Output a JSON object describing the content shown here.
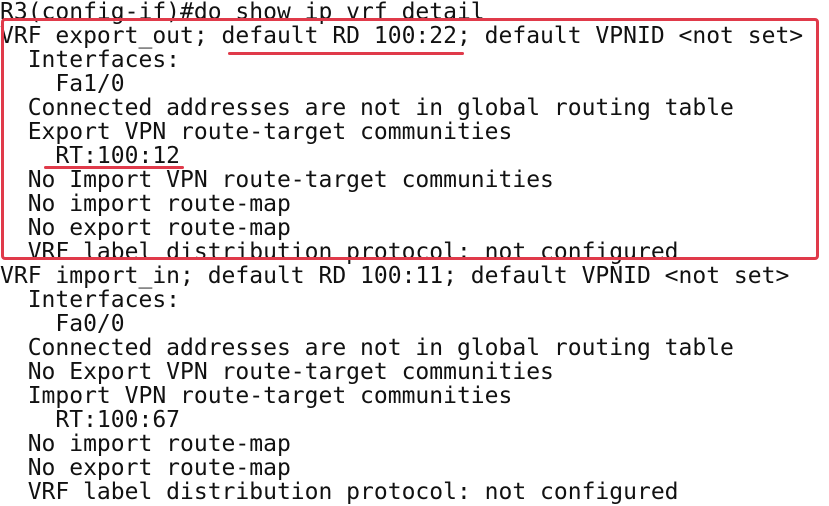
{
  "terminal": {
    "lines": [
      "R3(config-if)#do show ip vrf detail",
      "VRF export_out; default RD 100:22; default VPNID <not set>",
      "  Interfaces:",
      "    Fa1/0",
      "  Connected addresses are not in global routing table",
      "  Export VPN route-target communities",
      "    RT:100:12",
      "  No Import VPN route-target communities",
      "  No import route-map",
      "  No export route-map",
      "  VRF label distribution protocol: not configured",
      "VRF import_in; default RD 100:11; default VPNID <not set>",
      "  Interfaces:",
      "    Fa0/0",
      "  Connected addresses are not in global routing table",
      "  No Export VPN route-target communities",
      "  Import VPN route-target communities",
      "    RT:100:67",
      "  No import route-map",
      "  No export route-map",
      "  VRF label distribution protocol: not configured"
    ]
  },
  "annotations": {
    "accent_color": "#e03a4a"
  }
}
